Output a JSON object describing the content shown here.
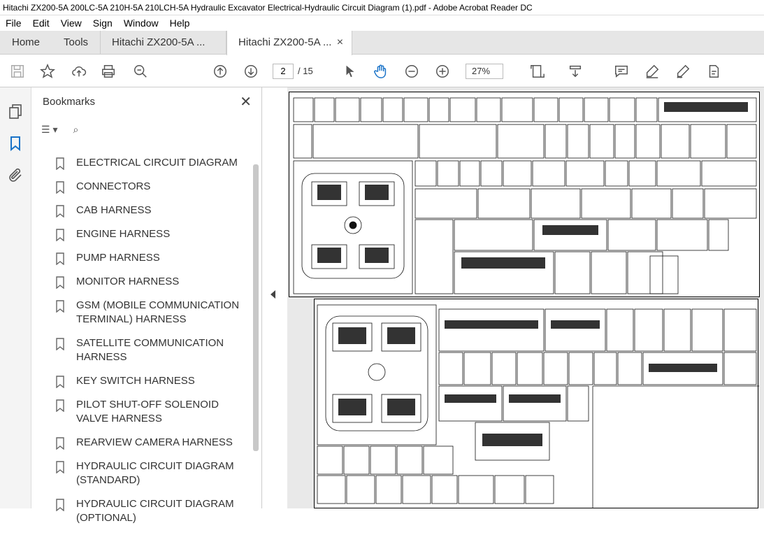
{
  "window": {
    "title": "Hitachi ZX200-5A 200LC-5A 210H-5A 210LCH-5A Hydraulic Excavator Electrical-Hydraulic Circuit Diagram (1).pdf - Adobe Acrobat Reader DC"
  },
  "menu": [
    "File",
    "Edit",
    "View",
    "Sign",
    "Window",
    "Help"
  ],
  "tabs": {
    "home": "Home",
    "tools": "Tools",
    "doc1": "Hitachi ZX200-5A ...",
    "doc2": "Hitachi ZX200-5A ...",
    "close": "×"
  },
  "toolbar": {
    "page_current": "2",
    "page_total": "/ 15",
    "zoom": "27%"
  },
  "bookmarks": {
    "header": "Bookmarks",
    "items": [
      {
        "label": "ELECTRICAL CIRCUIT DIAGRAM"
      },
      {
        "label": "CONNECTORS"
      },
      {
        "label": "CAB HARNESS"
      },
      {
        "label": "ENGINE HARNESS"
      },
      {
        "label": "PUMP HARNESS"
      },
      {
        "label": "MONITOR HARNESS"
      },
      {
        "label": "GSM (MOBILE COMMUNICATION TERMINAL) HARNESS"
      },
      {
        "label": "SATELLITE COMMUNICATION HARNESS"
      },
      {
        "label": "KEY SWITCH HARNESS"
      },
      {
        "label": "PILOT SHUT-OFF SOLENOID VALVE HARNESS"
      },
      {
        "label": "REARVIEW CAMERA HARNESS"
      },
      {
        "label": "HYDRAULIC CIRCUIT DIAGRAM (STANDARD)"
      },
      {
        "label": "HYDRAULIC CIRCUIT DIAGRAM (OPTIONAL)"
      }
    ]
  },
  "colors": {
    "accent": "#1a73c8",
    "tab_bg": "#e6e6e6"
  }
}
